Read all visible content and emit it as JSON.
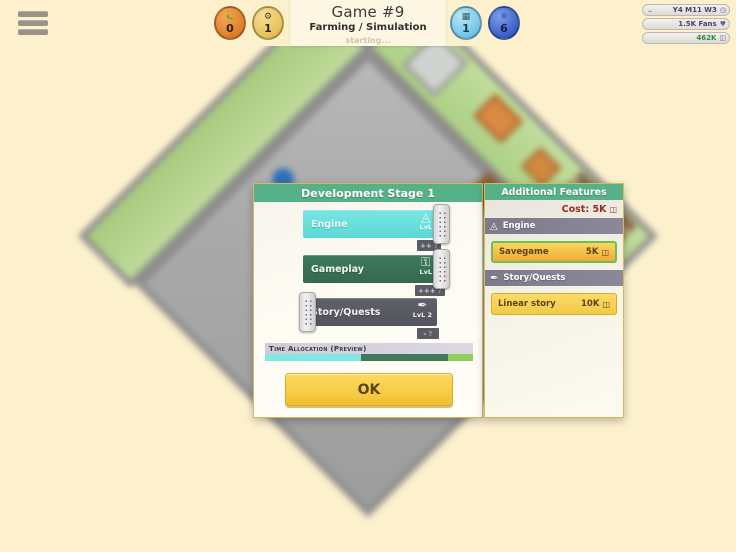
{
  "topbar": {
    "menu_icon": "hamburger-menu-icon",
    "badges_left": [
      {
        "icon": "bug-icon",
        "value": "0",
        "color": "#de7f2a"
      },
      {
        "icon": "flask-icon",
        "value": "1",
        "color": "#e8c257"
      }
    ],
    "badges_right": [
      {
        "icon": "chip-icon",
        "value": "1",
        "color": "#74c4e6"
      },
      {
        "icon": "atom-icon",
        "value": "6",
        "color": "#3e5fc8"
      }
    ],
    "title": {
      "name": "Game #9",
      "genre": "Farming / Simulation",
      "status": "starting..."
    },
    "stats": [
      {
        "icon": "clock-icon",
        "label": "Y4 M11 W3",
        "prefix": ".."
      },
      {
        "icon": "heart-icon",
        "label": "1.5K Fans"
      },
      {
        "icon": "money-icon",
        "label": "462K"
      }
    ]
  },
  "dialog": {
    "header": "Development Stage 1",
    "sliders": [
      {
        "name": "Engine",
        "icon": "cube-icon",
        "level_label": "LvL",
        "effect": "++",
        "effect_unknown": "?",
        "fill_percent": 72,
        "style": "engine"
      },
      {
        "name": "Gameplay",
        "icon": "joystick-icon",
        "level_label": "LvL",
        "effect": "+++",
        "effect_unknown": "?",
        "fill_percent": 72,
        "style": "gameplay"
      },
      {
        "name": "Story/Quests",
        "icon": "feather-icon",
        "level_label": "LvL 2",
        "effect": "-",
        "effect_unknown": "?",
        "fill_percent": 14,
        "style": "story"
      }
    ],
    "time_allocation": {
      "label": "Time Allocation (Preview)",
      "segments": [
        46,
        42,
        12
      ]
    },
    "ok_label": "OK"
  },
  "additional_features": {
    "header": "Additional Features",
    "cost_label": "Cost: 5K",
    "cost_icon": "money-icon",
    "groups": [
      {
        "name": "Engine",
        "icon": "cube-icon",
        "items": [
          {
            "name": "Savegame",
            "cost": "5K",
            "selected": true
          }
        ]
      },
      {
        "name": "Story/Quests",
        "icon": "feather-icon",
        "items": [
          {
            "name": "Linear story",
            "cost": "10K",
            "selected": false
          }
        ]
      }
    ]
  }
}
